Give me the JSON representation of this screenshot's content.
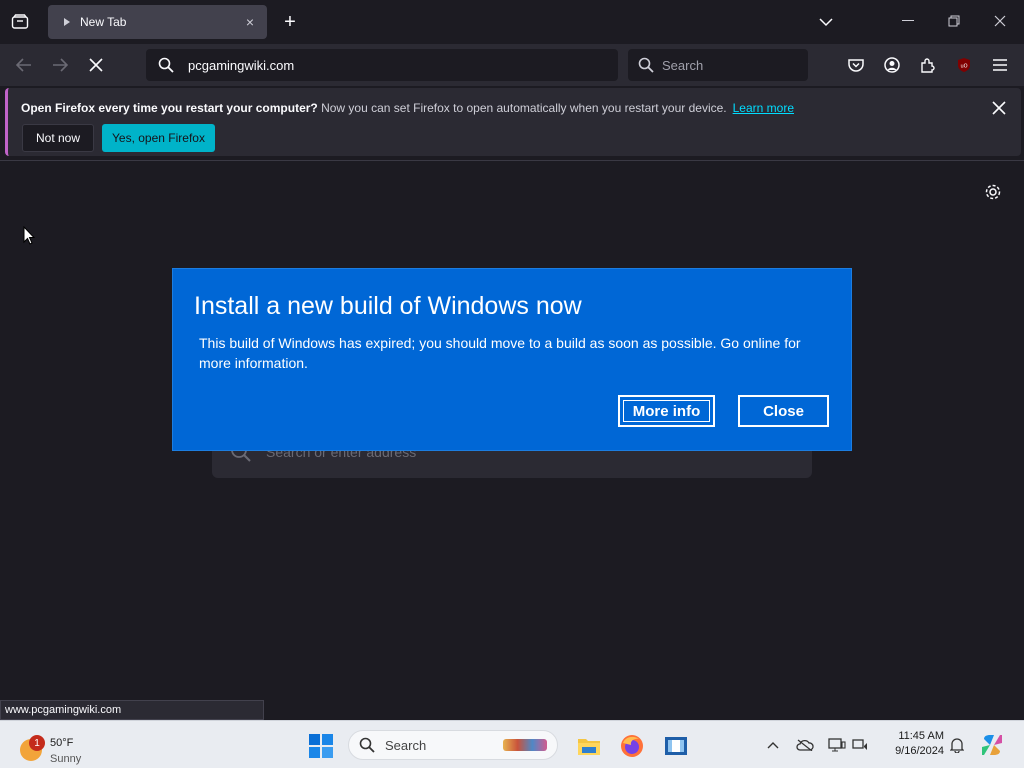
{
  "browser": {
    "tab": {
      "title": "New Tab",
      "close_label": "×"
    },
    "newtab_label": "+",
    "url": "pcgamingwiki.com",
    "search_placeholder": "Search"
  },
  "notification": {
    "bold": "Open Firefox every time you restart your computer?",
    "message": " Now you can set Firefox to open automatically when you restart your device.",
    "link": "Learn more",
    "not_now": "Not now",
    "yes": "Yes, open Firefox"
  },
  "page": {
    "search_placeholder": "Search or enter address"
  },
  "dialog": {
    "title": "Install a new build of Windows now",
    "body": "This build of Windows has expired; you should move to a build as soon as possible. Go online for more information.",
    "more_info": "More info",
    "close": "Close"
  },
  "status_url": "www.pcgamingwiki.com",
  "taskbar": {
    "weather": {
      "badge": "1",
      "temp": "50°F",
      "condition": "Sunny"
    },
    "search": "Search",
    "time": "11:45 AM",
    "date": "9/16/2024"
  },
  "colors": {
    "dialog_bg": "#0067d6",
    "accent": "#00b3c9",
    "link": "#00ddff"
  }
}
